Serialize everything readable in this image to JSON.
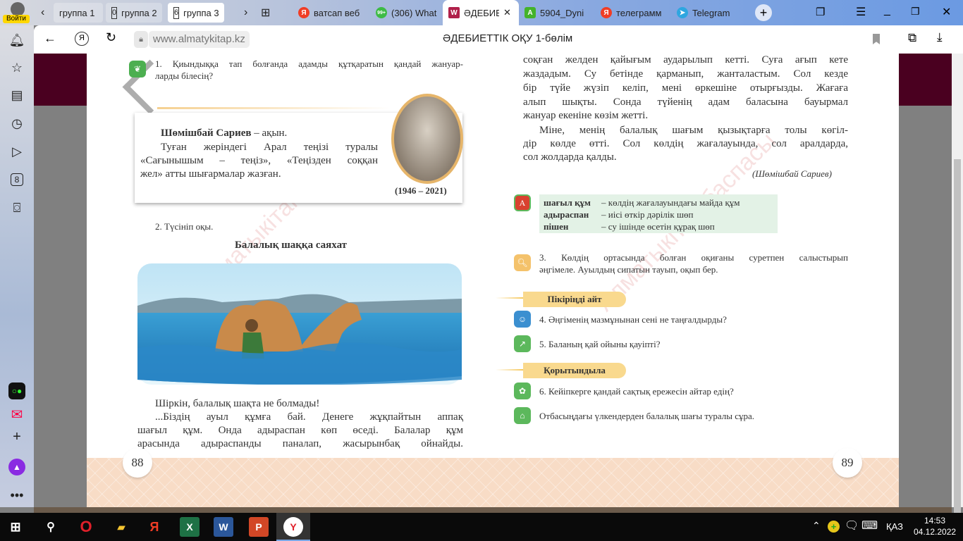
{
  "browser": {
    "login_label": "Войти",
    "tab_groups": [
      {
        "count": "",
        "label": "группа 1"
      },
      {
        "count": "0",
        "label": "группа 2"
      },
      {
        "count": "6",
        "label": "группа 3"
      }
    ],
    "tabs": [
      {
        "label": "ватсап веб",
        "icon": "yandex-icon",
        "color": "#f03d25",
        "glyph": "Я"
      },
      {
        "label": "(306) What",
        "icon": "whatsapp-icon",
        "color": "#3dbb45",
        "glyph": "99+"
      },
      {
        "label": "ӘДЕБИЕ",
        "icon": "book-icon",
        "color": "#b0204a",
        "glyph": "W",
        "active": true
      },
      {
        "label": "5904_Dyni",
        "icon": "android-icon",
        "color": "#44b32a",
        "glyph": "A"
      },
      {
        "label": "телеграмм",
        "icon": "yandex-icon",
        "color": "#f03d25",
        "glyph": "Я"
      },
      {
        "label": "Telegram",
        "icon": "telegram-icon",
        "color": "#2ea6e0",
        "glyph": "➤"
      }
    ],
    "url": "www.almatykitap.kz",
    "page_title": "ӘДЕБИЕТТІК ОҚУ 1-бөлім"
  },
  "book": {
    "watermark": "Алматыкітап баспасы",
    "left": {
      "q1": [
        "1. Қиындыққа тап болғанда адамды құтқаратын қандай жануар-",
        "ларды білесің?"
      ],
      "bio_name": "Шөмішбай Сариев",
      "bio_role": " – ақын.",
      "bio_lines": [
        "Туған жеріндегі Арал теңізі туралы",
        "«Сағынышым – теңіз», «Теңізден соққан",
        "жел» атты шығармалар жазған."
      ],
      "years": "(1946 – 2021)",
      "task2": "2. Түсініп оқы.",
      "story_title": "Балалық шаққа саяхат",
      "text": [
        "Шіркін, балалық шақта не болмады!",
        "...Біздің ауыл құмға бай. Денеге жұқпайтын аппақ",
        "шағыл құм. Онда адыраспан көп өседі. Балалар құм",
        "арасында адыраспанды паналап, жасырынбақ ойнайды."
      ],
      "page_number": "88"
    },
    "right": {
      "text": [
        "соқған желден қайығым аударылып кетті. Суға ағып кете",
        "жаздадым. Су бетінде қарманып, жанталастым. Сол кезде",
        "бір түйе жүзіп келіп, мені өркешіне отырғызды. Жағаға",
        "алып шықты. Сонда түйенің адам баласына бауырмал",
        "жануар екеніне көзім жетті."
      ],
      "text2": [
        "Міне, менің балалық шағым қызықтарға толы көгіл-",
        "дір көлде өтті. Сол көлдің жағалауында, сол аралдарда,",
        "сол жолдарда қалды."
      ],
      "author": "(Шөмішбай Сариев)",
      "glossary": [
        {
          "term": "шағыл құм",
          "def": "– көлдің жағалауындағы майда құм"
        },
        {
          "term": "адыраспан",
          "def": "– иісі өткір дәрілік шөп"
        },
        {
          "term": "пішен",
          "def": "– су ішінде өсетін құрақ шөп"
        }
      ],
      "q3": [
        "3. Көлдің ортасында болған оқиғаны суретпен салыстырып",
        "әңгімеле. Ауылдың сипатын тауып, оқып бер."
      ],
      "section1": "Пікіріңді айт",
      "q4": "4. Әңгіменің мазмұнынан сені не таңғалдырды?",
      "q5": "5. Баланың қай ойыны қауіпті?",
      "section2": "Қорытындыла",
      "q6": "6. Кейіпкерге қандай сақтық ережесін айтар едің?",
      "q7": "Отбасыңдағы үлкендерден балалық шағы туралы сұра.",
      "page_number": "89"
    }
  },
  "taskbar": {
    "time": "14:53",
    "date": "04.12.2022",
    "lang": "ҚАЗ"
  }
}
